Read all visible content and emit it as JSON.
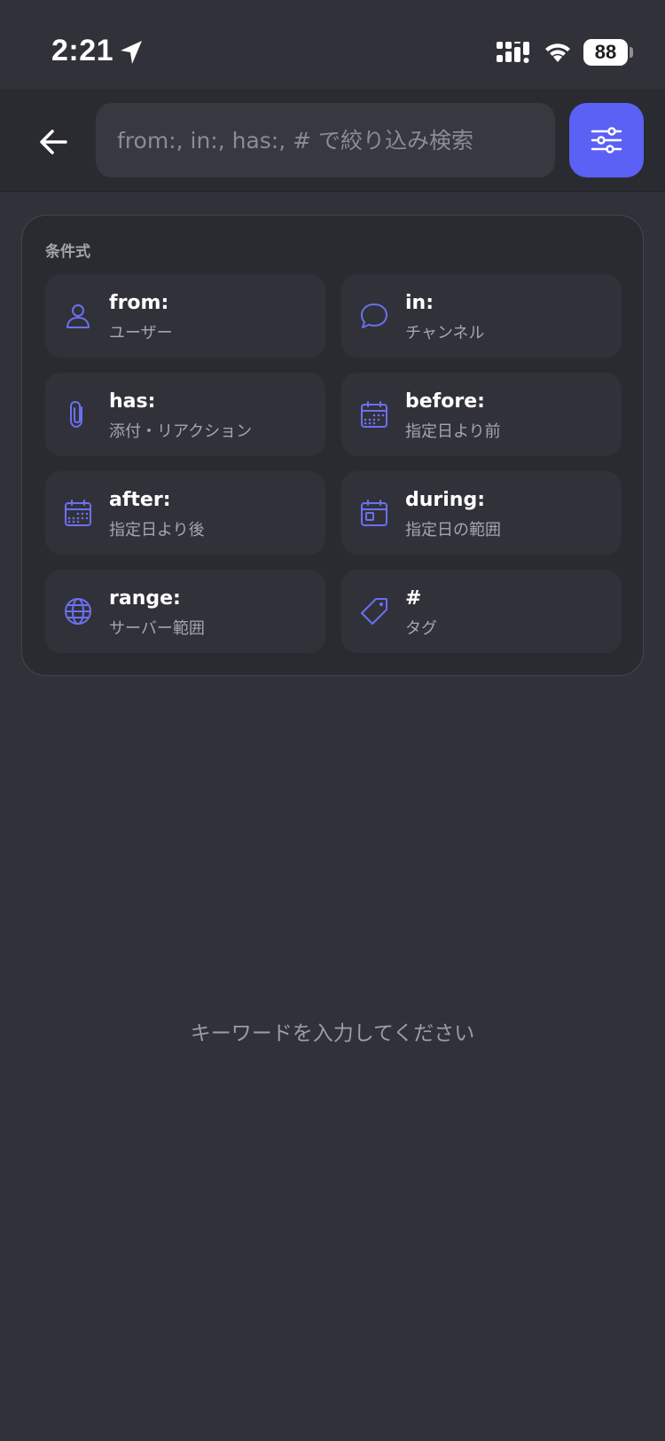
{
  "status_bar": {
    "time": "2:21",
    "battery": "88"
  },
  "header": {
    "search_placeholder": "from:, in:, has:, # で絞り込み検索"
  },
  "panel": {
    "title": "条件式",
    "conditions": [
      {
        "label": "from:",
        "desc": "ユーザー",
        "icon": "user-icon"
      },
      {
        "label": "in:",
        "desc": "チャンネル",
        "icon": "chat-bubble-icon"
      },
      {
        "label": "has:",
        "desc": "添付・リアクション",
        "icon": "paperclip-icon"
      },
      {
        "label": "before:",
        "desc": "指定日より前",
        "icon": "calendar-icon"
      },
      {
        "label": "after:",
        "desc": "指定日より後",
        "icon": "calendar-icon"
      },
      {
        "label": "during:",
        "desc": "指定日の範囲",
        "icon": "calendar-range-icon"
      },
      {
        "label": "range:",
        "desc": "サーバー範囲",
        "icon": "globe-icon"
      },
      {
        "label": "#",
        "desc": "タグ",
        "icon": "tag-icon"
      }
    ]
  },
  "empty_state": {
    "message": "キーワードを入力してください"
  },
  "colors": {
    "accent": "#5b61f4",
    "background": "#313239",
    "surface": "#2a2b31"
  }
}
